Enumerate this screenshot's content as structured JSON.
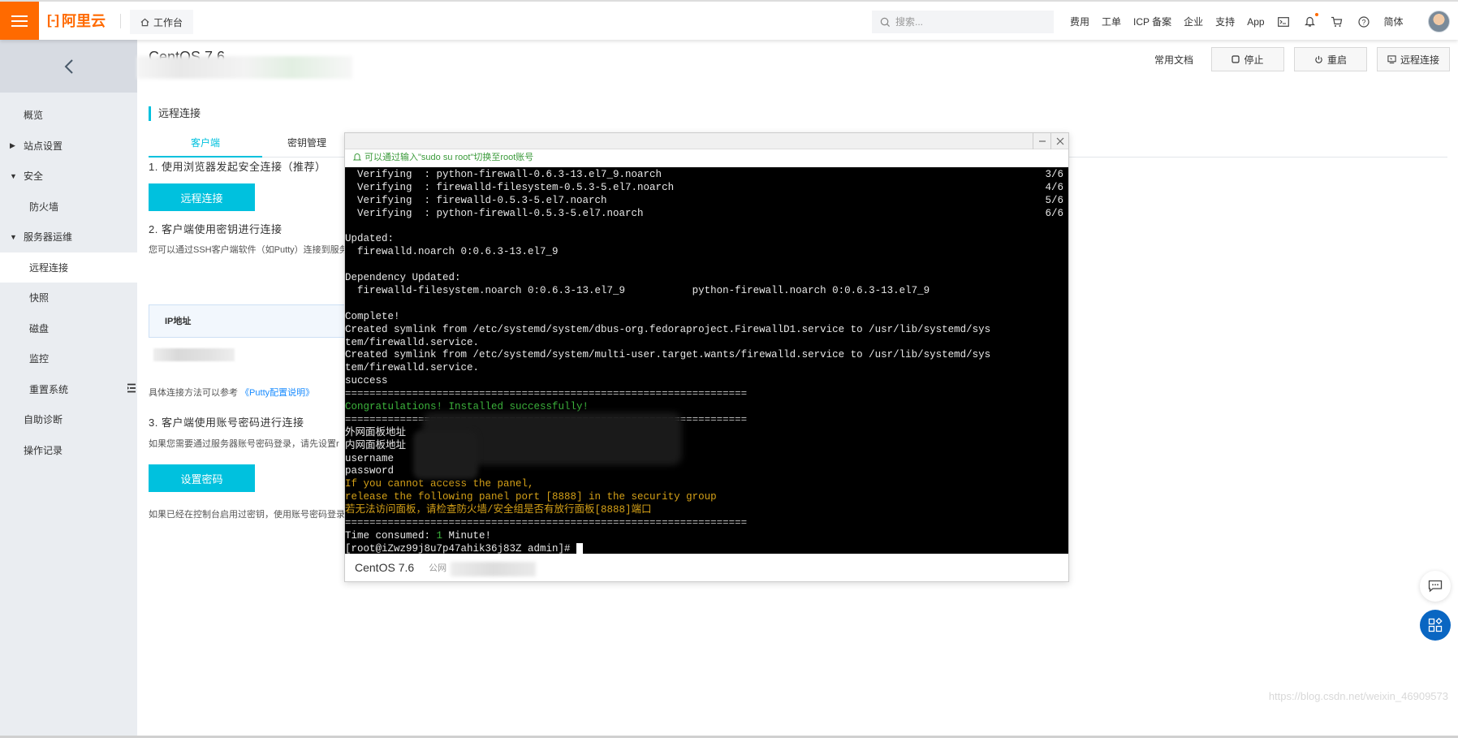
{
  "topbar": {
    "brand": "阿里云",
    "workbench": "工作台",
    "search_placeholder": "搜索...",
    "links": [
      "费用",
      "工单",
      "ICP 备案",
      "企业",
      "支持",
      "App"
    ],
    "language": "简体",
    "icons": [
      "terminal-icon",
      "bell-icon",
      "cart-icon",
      "help-icon"
    ]
  },
  "sidebar": {
    "items": [
      {
        "label": "概览",
        "level": "top"
      },
      {
        "label": "站点设置",
        "level": "top",
        "caret": "▶"
      },
      {
        "label": "安全",
        "level": "top",
        "caret": "▼"
      },
      {
        "label": "防火墙",
        "level": "sub"
      },
      {
        "label": "服务器运维",
        "level": "top",
        "caret": "▼"
      },
      {
        "label": "远程连接",
        "level": "sub",
        "active": true
      },
      {
        "label": "快照",
        "level": "sub"
      },
      {
        "label": "磁盘",
        "level": "sub"
      },
      {
        "label": "监控",
        "level": "sub"
      },
      {
        "label": "重置系统",
        "level": "sub"
      },
      {
        "label": "自助诊断",
        "level": "top"
      },
      {
        "label": "操作记录",
        "level": "top"
      }
    ]
  },
  "main": {
    "title": "CentOS 7.6",
    "actions": {
      "docs": "常用文档",
      "stop": "停止",
      "restart": "重启",
      "remote": "远程连接"
    },
    "section_title": "远程连接",
    "tabs": [
      {
        "label": "客户端",
        "active": true
      },
      {
        "label": "密钥管理",
        "active": false
      }
    ],
    "step1": "1. 使用浏览器发起安全连接（推荐）",
    "step1_button": "远程连接",
    "step2": "2. 客户端使用密钥进行连接",
    "step2_desc": "您可以通过SSH客户端软件（如Putty）连接到服务",
    "ip_header": "IP地址",
    "putty_prefix": "具体连接方法可以参考",
    "putty_link": "《Putty配置说明》",
    "step3": "3. 客户端使用账号密码进行连接",
    "step3_desc": "如果您需要通过服务器账号密码登录，请先设置r",
    "step3_button": "设置密码",
    "step3_note": "如果已经在控制台启用过密钥，使用账号密码登录"
  },
  "terminal": {
    "notice": "可以通过输入\"sudo su root\"切换至root账号",
    "lines": [
      {
        "text": "  Verifying  : python-firewall-0.6.3-13.el7_9.noarch",
        "right": "3/6"
      },
      {
        "text": "  Verifying  : firewalld-filesystem-0.5.3-5.el7.noarch",
        "right": "4/6"
      },
      {
        "text": "  Verifying  : firewalld-0.5.3-5.el7.noarch",
        "right": "5/6"
      },
      {
        "text": "  Verifying  : python-firewall-0.5.3-5.el7.noarch",
        "right": "6/6"
      },
      {
        "text": ""
      },
      {
        "text": "Updated:"
      },
      {
        "text": "  firewalld.noarch 0:0.6.3-13.el7_9"
      },
      {
        "text": ""
      },
      {
        "text": "Dependency Updated:"
      },
      {
        "text": "  firewalld-filesystem.noarch 0:0.6.3-13.el7_9           python-firewall.noarch 0:0.6.3-13.el7_9"
      },
      {
        "text": ""
      },
      {
        "text": "Complete!"
      },
      {
        "text": "Created symlink from /etc/systemd/system/dbus-org.fedoraproject.FirewallD1.service to /usr/lib/systemd/sys"
      },
      {
        "text": "tem/firewalld.service."
      },
      {
        "text": "Created symlink from /etc/systemd/system/multi-user.target.wants/firewalld.service to /usr/lib/systemd/sys"
      },
      {
        "text": "tem/firewalld.service."
      },
      {
        "text": "success"
      },
      {
        "text": "==================================================================",
        "style": "sep"
      },
      {
        "text": "Congratulations! Installed successfully!",
        "style": "green"
      },
      {
        "text": "==================================================================",
        "style": "sep"
      },
      {
        "text": "外网面板地址"
      },
      {
        "text": "内网面板地址"
      },
      {
        "text": "username"
      },
      {
        "text": "password"
      },
      {
        "text": "If you cannot access the panel,",
        "style": "yellow"
      },
      {
        "text": "release the following panel port [8888] in the security group",
        "style": "yellow"
      },
      {
        "text": "若无法访问面板，请检查防火墙/安全组是否有放行面板[8888]端口",
        "style": "yellow"
      },
      {
        "text": "==================================================================",
        "style": "sep"
      },
      {
        "text": "Time consumed: 1 Minute!"
      },
      {
        "text": "[root@iZwz99j8u7p47ahik36j83Z admin]# "
      }
    ],
    "time_prefix": "Time consumed: ",
    "time_value": "1",
    "time_suffix": " Minute!",
    "footer_os": "CentOS 7.6",
    "footer_pub": "公网"
  },
  "watermark": "https://blog.csdn.net/weixin_46909573"
}
